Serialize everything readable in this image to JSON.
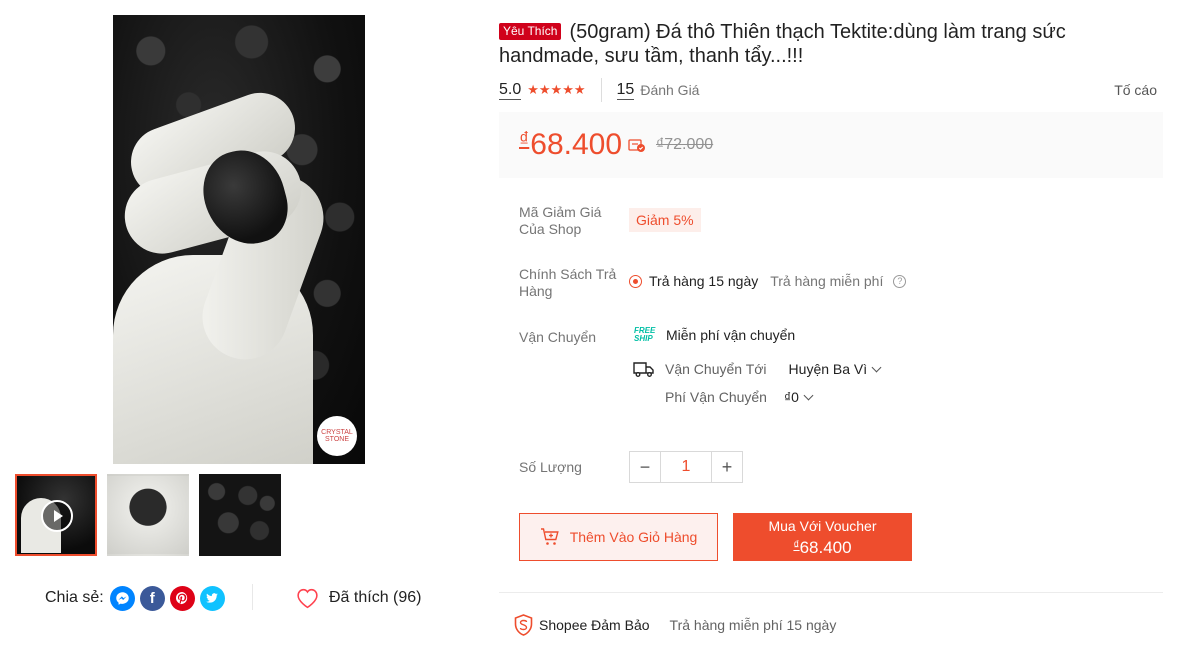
{
  "gallery": {
    "main_watermark": "CRYSTAL STONE",
    "thumbnails": [
      {
        "kind": "video",
        "active": true
      },
      {
        "kind": "image",
        "active": false
      },
      {
        "kind": "image",
        "active": false
      }
    ]
  },
  "share": {
    "label": "Chia sẻ:",
    "networks": [
      "messenger-icon",
      "facebook-icon",
      "pinterest-icon",
      "twitter-icon"
    ]
  },
  "like": {
    "label": "Đã thích (96)"
  },
  "product": {
    "badge": "Yêu Thích",
    "title": "(50gram) Đá thô Thiên thạch Tektite:dùng làm trang sức handmade, sưu tầm, thanh tẩy...!!!",
    "rating": "5.0",
    "stars": "★★★★★",
    "review_count": "15",
    "review_label": "Đánh Giá",
    "report_label": "Tố cáo"
  },
  "price": {
    "currency": "₫",
    "current": "68.400",
    "original": "₫72.000"
  },
  "voucher": {
    "label": "Mã Giảm Giá Của Shop",
    "tag": "Giảm 5%"
  },
  "return_policy": {
    "label": "Chính Sách Trả Hàng",
    "days": "Trả hàng 15 ngày",
    "free": "Trả hàng miễn phí"
  },
  "shipping": {
    "label": "Vận Chuyển",
    "free_icon_top": "FREE",
    "free_icon_bottom": "SHIP",
    "free_text": "Miễn phí vận chuyển",
    "to_label": "Vận Chuyển Tới",
    "to_value": "Huyện Ba Vì",
    "fee_label": "Phí Vận Chuyển",
    "fee_value": "₫0"
  },
  "quantity": {
    "label": "Số Lượng",
    "value": "1",
    "minus": "−",
    "plus": "+"
  },
  "actions": {
    "add_to_cart": "Thêm Vào Giỏ Hàng",
    "buy_voucher_line1": "Mua Với Voucher",
    "buy_voucher_currency": "₫",
    "buy_voucher_price": "68.400"
  },
  "guarantee": {
    "label": "Shopee Đảm Bảo",
    "detail": "Trả hàng miễn phí 15 ngày"
  },
  "colors": {
    "accent": "#ee4d2d",
    "badge": "#d0011b"
  }
}
